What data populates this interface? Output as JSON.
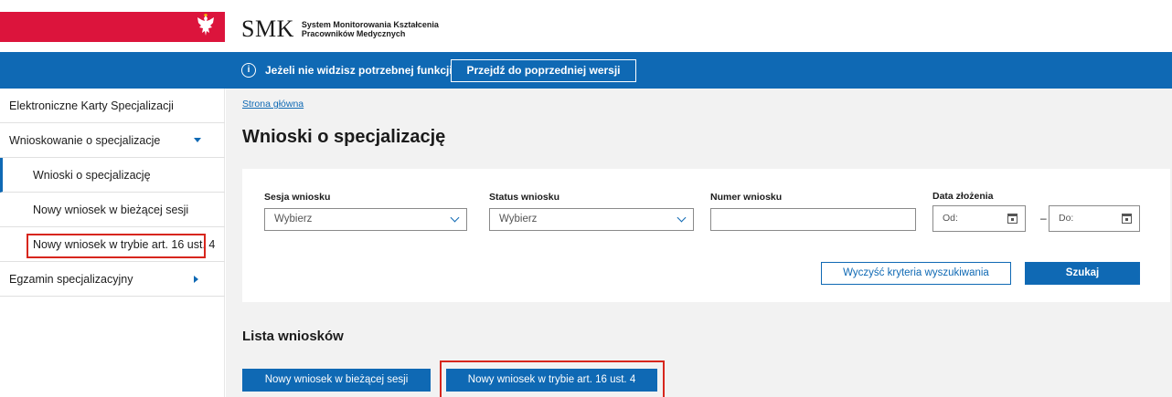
{
  "header": {
    "logo_main": "SMK",
    "logo_line1": "System Monitorowania Kształcenia",
    "logo_line2": "Pracowników Medycznych"
  },
  "infobar": {
    "text": "Jeżeli nie widzisz potrzebnej funkcji",
    "button": "Przejdź do poprzedniej wersji"
  },
  "sidebar": {
    "items": [
      {
        "label": "Elektroniczne Karty Specjalizacji"
      },
      {
        "label": "Wnioskowanie o specjalizacje"
      },
      {
        "label": "Wnioski o specjalizację"
      },
      {
        "label": "Nowy wniosek w bieżącej sesji"
      },
      {
        "label": "Nowy wniosek w trybie art. 16 ust. 4"
      },
      {
        "label": "Egzamin specjalizacyjny"
      }
    ]
  },
  "main": {
    "breadcrumb": "Strona główna",
    "title": "Wnioski o specjalizację",
    "filters": {
      "session_label": "Sesja wniosku",
      "session_value": "Wybierz",
      "status_label": "Status wniosku",
      "status_value": "Wybierz",
      "number_label": "Numer wniosku",
      "date_label": "Data złożenia",
      "date_from": "Od:",
      "date_to": "Do:",
      "dash": "–",
      "clear_button": "Wyczyść kryteria wyszukiwania",
      "search_button": "Szukaj"
    },
    "list_title": "Lista wniosków",
    "new_current_button": "Nowy wniosek w bieżącej sesji",
    "new_art_button": "Nowy wniosek w trybie art. 16 ust. 4"
  },
  "colors": {
    "brand_blue": "#0f69b4",
    "flag_red": "#dc143c",
    "highlight_red": "#d7261d"
  }
}
